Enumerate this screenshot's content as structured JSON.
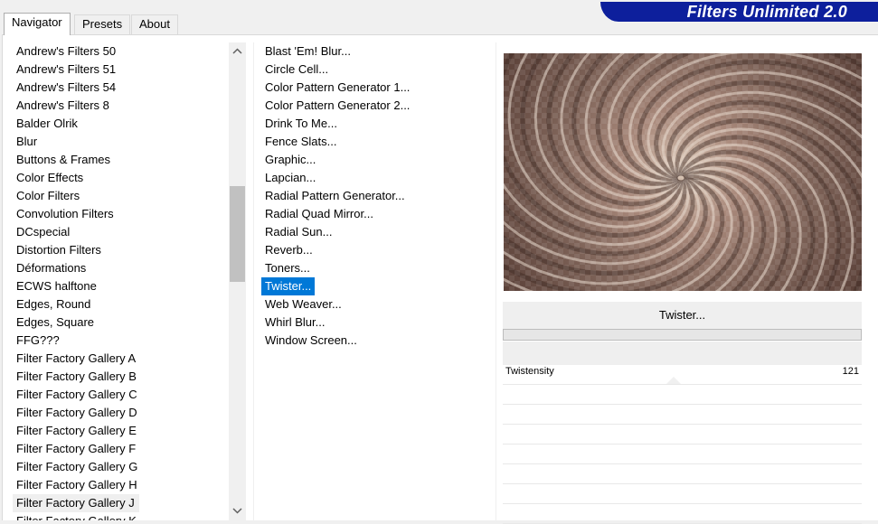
{
  "tabs": [
    {
      "label": "Navigator",
      "active": true
    },
    {
      "label": "Presets",
      "active": false
    },
    {
      "label": "About",
      "active": false
    }
  ],
  "brand_title": "Filters Unlimited 2.0",
  "categories": [
    "Andrew's Filters 50",
    "Andrew's Filters 51",
    "Andrew's Filters 54",
    "Andrew's Filters 8",
    "Balder Olrik",
    "Blur",
    "Buttons & Frames",
    "Color Effects",
    "Color Filters",
    "Convolution Filters",
    "DCspecial",
    "Distortion Filters",
    "Déformations",
    "ECWS halftone",
    "Edges, Round",
    "Edges, Square",
    "FFG???",
    "Filter Factory Gallery A",
    "Filter Factory Gallery B",
    "Filter Factory Gallery C",
    "Filter Factory Gallery D",
    "Filter Factory Gallery E",
    "Filter Factory Gallery F",
    "Filter Factory Gallery G",
    "Filter Factory Gallery H",
    "Filter Factory Gallery J",
    "Filter Factory Gallery K"
  ],
  "selected_category": "Filter Factory Gallery J",
  "filters": [
    "Blast 'Em! Blur...",
    "Circle Cell...",
    "Color Pattern Generator 1...",
    "Color Pattern Generator 2...",
    "Drink To Me...",
    "Fence Slats...",
    "Graphic...",
    "Lapcian...",
    "Radial Pattern Generator...",
    "Radial Quad Mirror...",
    "Radial Sun...",
    "Reverb...",
    "Toners...",
    "Twister...",
    "Web Weaver...",
    "Whirl Blur...",
    "Window Screen..."
  ],
  "selected_filter": "Twister...",
  "filter_title": "Twister...",
  "progress_fraction": 0,
  "params": [
    {
      "name": "Twistensity",
      "value": "121"
    }
  ],
  "empty_param_rows": 7,
  "colors": {
    "selection": "#0078d7",
    "brand": "#0d1f9c"
  }
}
